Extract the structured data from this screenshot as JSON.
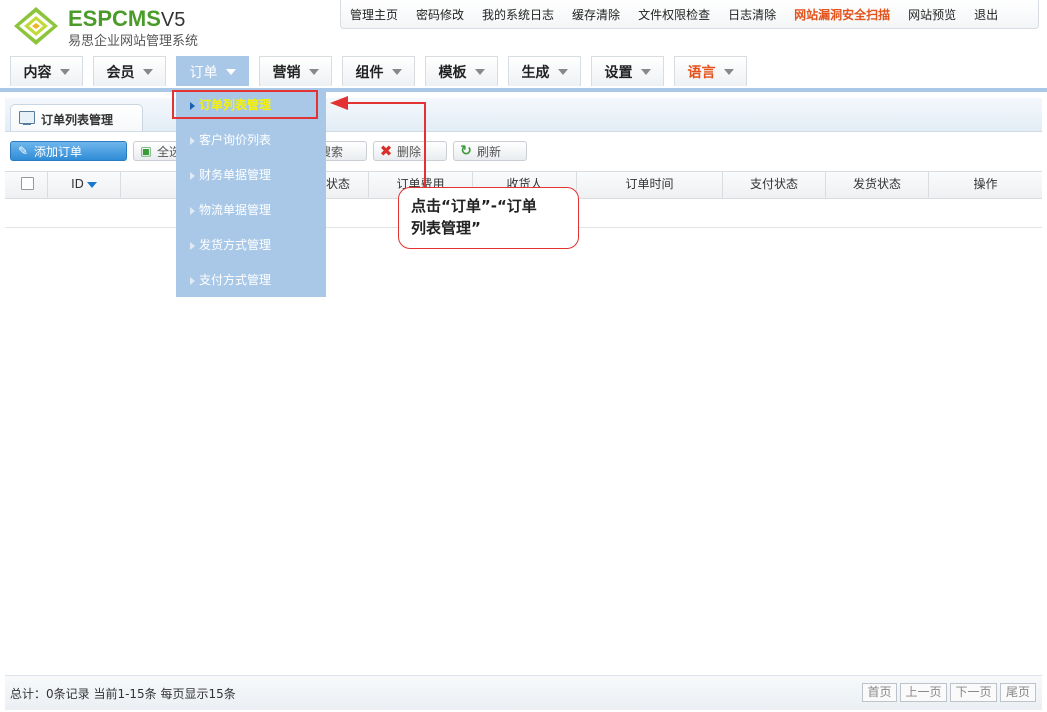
{
  "brand": {
    "name": "ESPCMS",
    "version": "V5",
    "subtitle": "易思企业网站管理系统"
  },
  "top_links": [
    {
      "label": "管理主页"
    },
    {
      "label": "密码修改"
    },
    {
      "label": "我的系统日志"
    },
    {
      "label": "缓存清除"
    },
    {
      "label": "文件权限检查"
    },
    {
      "label": "日志清除"
    },
    {
      "label": "网站漏洞安全扫描",
      "highlight": true
    },
    {
      "label": "网站预览"
    },
    {
      "label": "退出"
    }
  ],
  "nav": [
    {
      "label": "内容"
    },
    {
      "label": "会员"
    },
    {
      "label": "订单",
      "active": true
    },
    {
      "label": "营销"
    },
    {
      "label": "组件"
    },
    {
      "label": "模板"
    },
    {
      "label": "生成"
    },
    {
      "label": "设置"
    },
    {
      "label": "语言",
      "lang": true
    }
  ],
  "page_tab": "订单列表管理",
  "toolbar": {
    "add": "添加订单",
    "select_all": "全选",
    "search": "搜索",
    "delete": "删除",
    "refresh": "刷新"
  },
  "table": {
    "columns": [
      "ID",
      "状态",
      "订单费用",
      "收货人",
      "订单时间",
      "支付状态",
      "发货状态",
      "操作"
    ]
  },
  "dropdown": [
    {
      "label": "订单列表管理",
      "selected": true
    },
    {
      "label": "客户询价列表"
    },
    {
      "label": "财务单据管理"
    },
    {
      "label": "物流单据管理"
    },
    {
      "label": "发货方式管理"
    },
    {
      "label": "支付方式管理"
    }
  ],
  "annotation": {
    "line1": "点击“订单”-“订单",
    "line2": "列表管理”"
  },
  "footer": {
    "summary": "总计：0条记录 当前1-15条 每页显示15条",
    "first": "首页",
    "prev": "上一页",
    "next": "下一页",
    "last": "尾页"
  },
  "colors": {
    "accent": "#a9c8e8",
    "alert": "#e23232",
    "brand_green": "#4b9b2a",
    "hot": "#e4531b"
  }
}
